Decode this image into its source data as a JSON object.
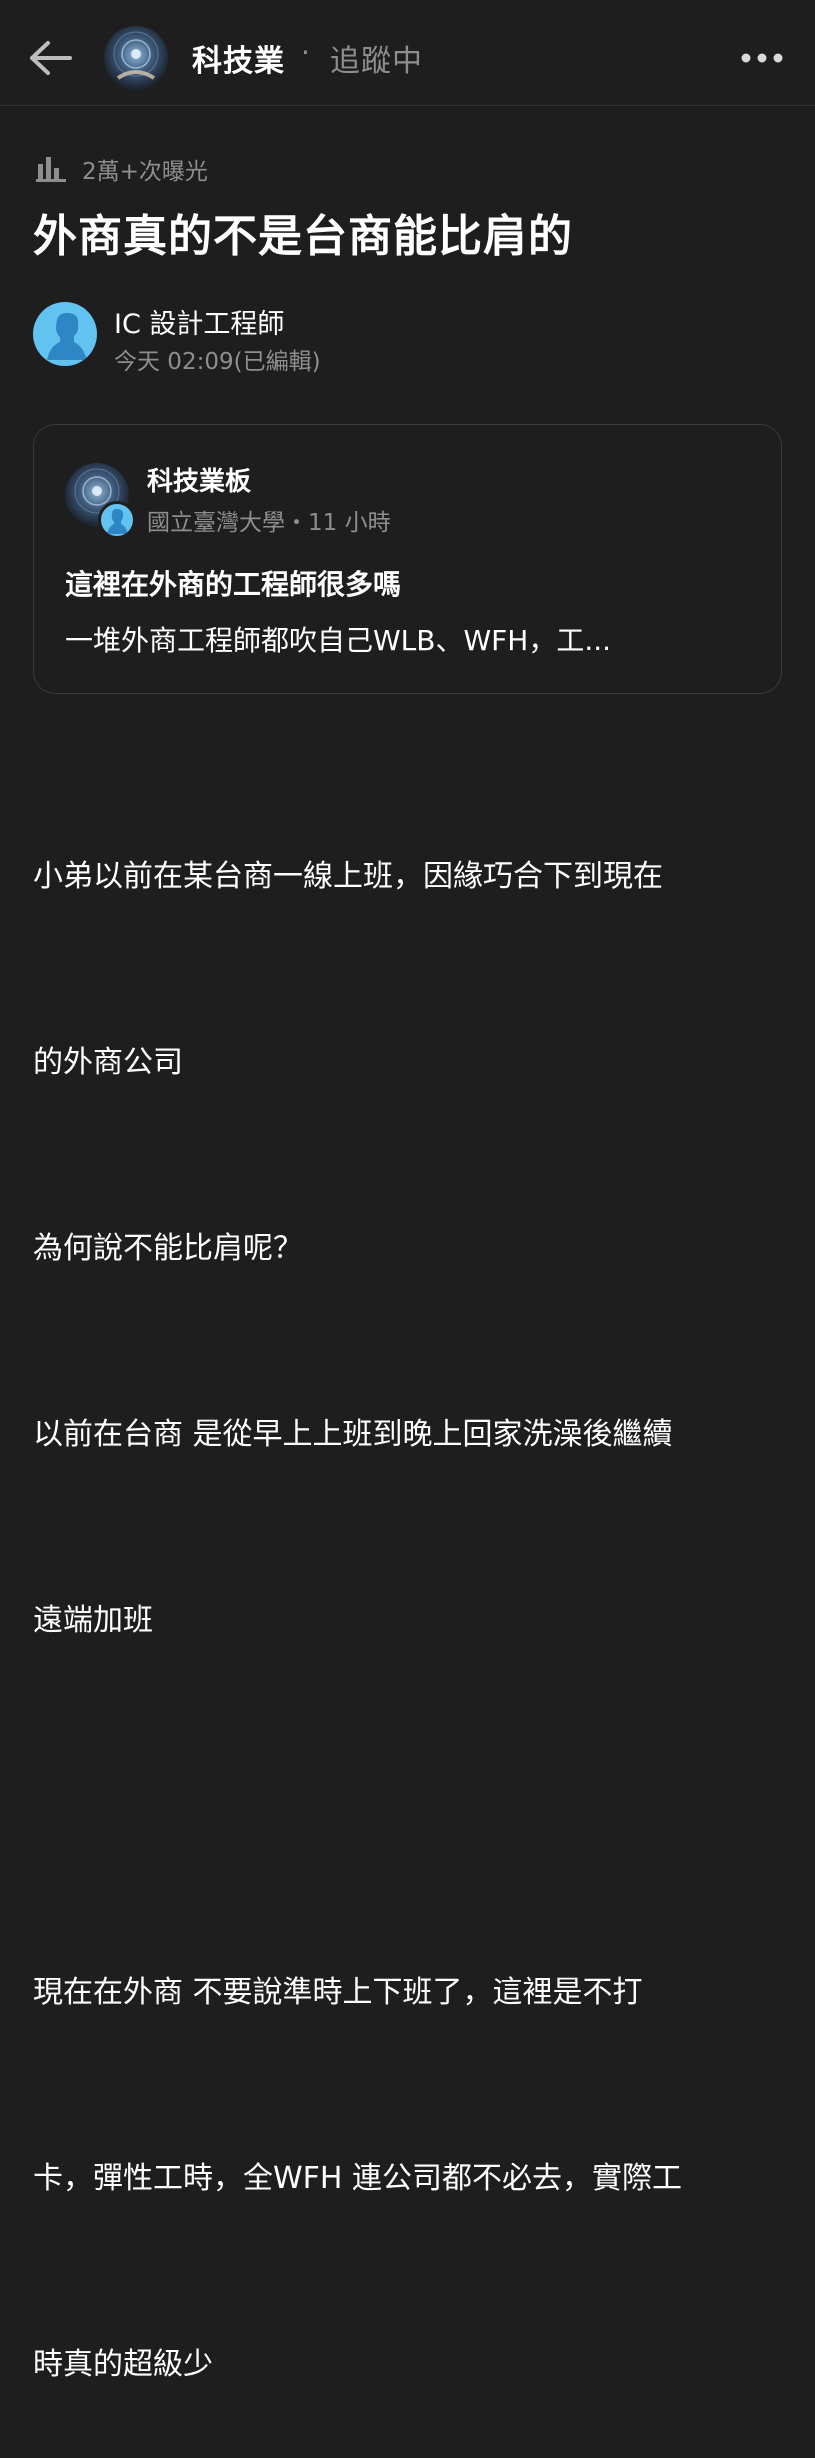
{
  "header": {
    "back_icon": "arrow-left-icon",
    "board_name": "科技業",
    "separator": "·",
    "follow_status": "追蹤中",
    "more_icon": "more-horizontal-icon"
  },
  "post": {
    "views_icon": "bar-chart-icon",
    "views": "2萬+次曝光",
    "title": "外商真的不是台商能比肩的",
    "author": {
      "name": "IC 設計工程師",
      "time": "今天 02:09(已編輯)"
    },
    "quoted": {
      "board": "科技業板",
      "meta": "國立臺灣大學・11 小時",
      "title": "這裡在外商的工程師很多嗎",
      "snippet": "一堆外商工程師都吹自己WLB、WFH，工..."
    },
    "body_lines": [
      "小弟以前在某台商一線上班，因緣巧合下到現在",
      "的外商公司",
      "為何說不能比肩呢？",
      "以前在台商 是從早上上班到晚上回家洗澡後繼續",
      "遠端加班",
      "",
      "現在在外商 不要說準時上下班了，這裡是不打",
      "卡，彈性工時，全WFH 連公司都不必去，實際工",
      "時真的超級少"
    ]
  },
  "colors": {
    "background": "#1e1e1f",
    "text": "#ffffff",
    "muted": "#8e8e90",
    "avatar_blue": "#62c3f0",
    "border": "#3a3a3c"
  }
}
